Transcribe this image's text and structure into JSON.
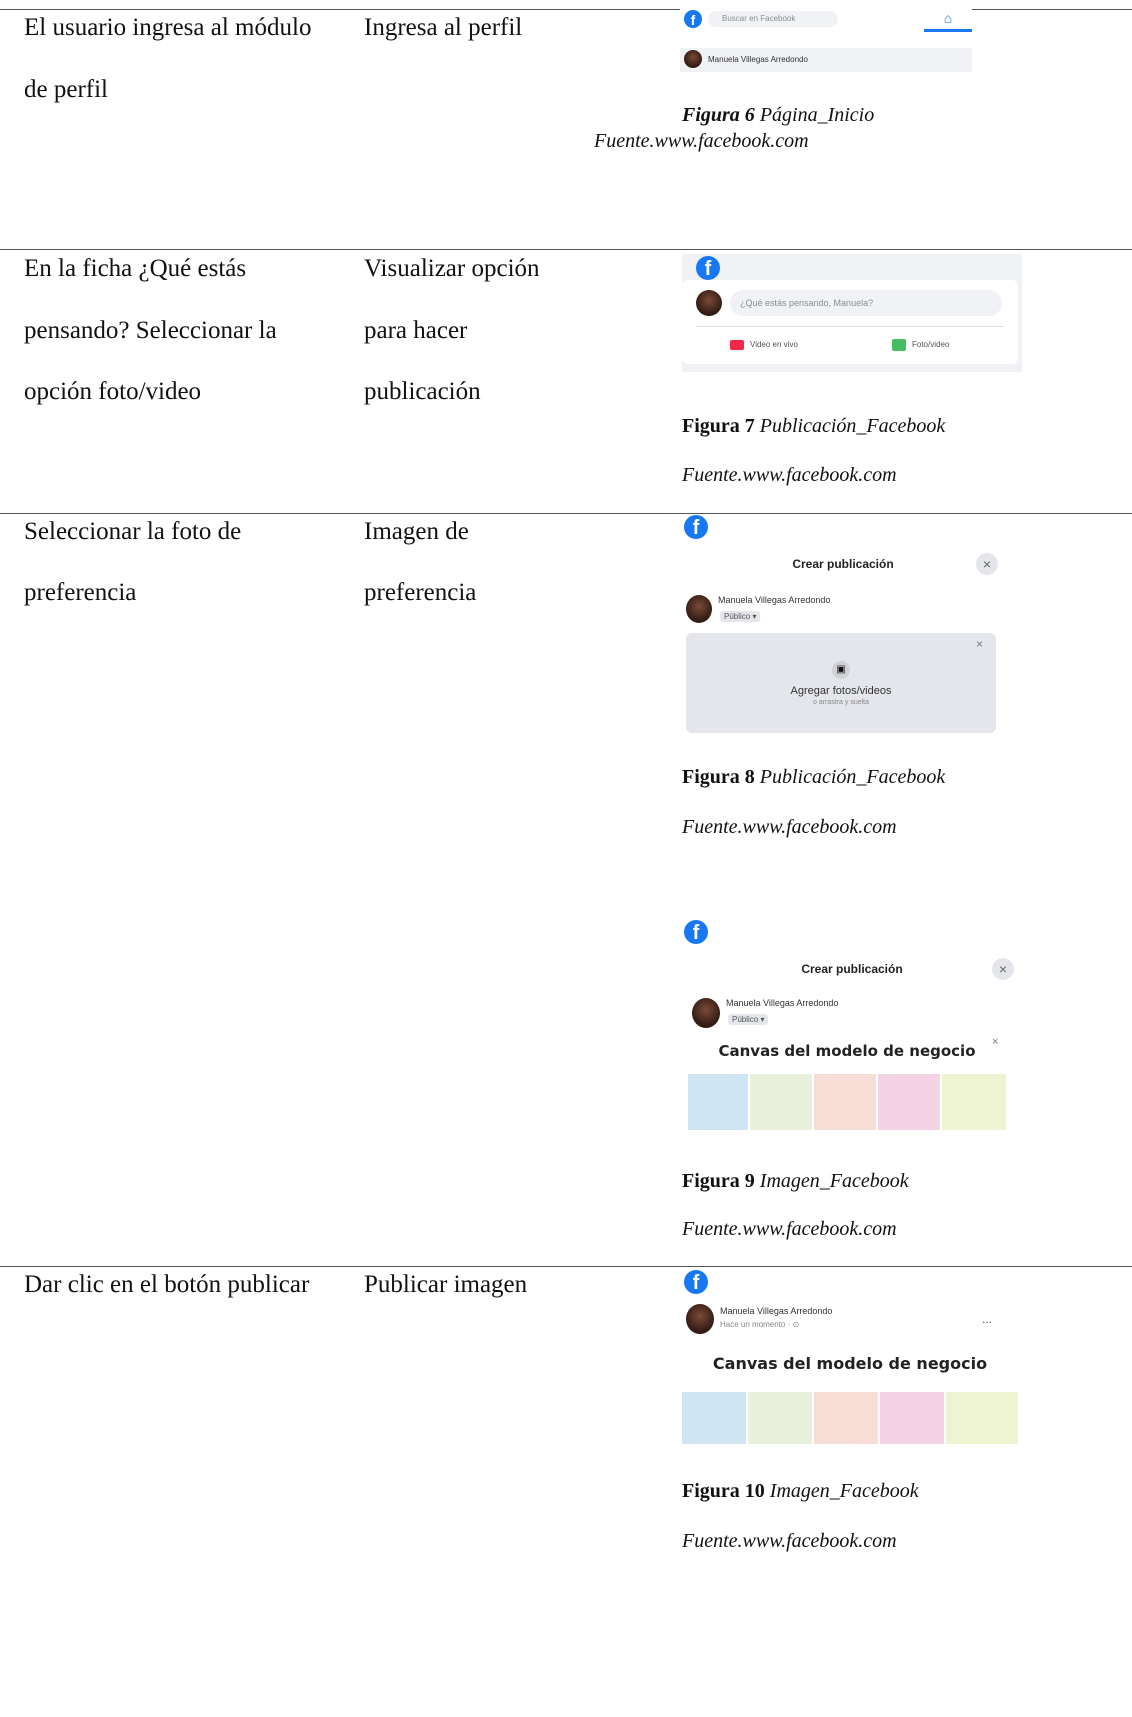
{
  "rows": [
    {
      "action": [
        "El usuario ingresa al módulo",
        "de perfil"
      ],
      "result": [
        "Ingresa al perfil"
      ]
    },
    {
      "action": [
        "En la ficha ¿Qué estás",
        "pensando? Seleccionar la",
        "opción foto/video"
      ],
      "result": [
        "Visualizar opción",
        "para hacer",
        "publicación"
      ]
    },
    {
      "action": [
        "Seleccionar la foto de",
        "preferencia"
      ],
      "result": [
        "Imagen de",
        "preferencia"
      ]
    },
    {
      "action": [
        "Dar clic en el botón publicar"
      ],
      "result": [
        "Publicar imagen"
      ]
    }
  ],
  "figures": {
    "f6": {
      "label": "Figura 6",
      "title": "Página_Inicio",
      "source": "Fuente.www.facebook.com"
    },
    "f7": {
      "label": "Figura 7",
      "title": "Publicación_Facebook",
      "source": "Fuente.www.facebook.com"
    },
    "f8": {
      "label": "Figura 8",
      "title": "Publicación_Facebook",
      "source": "Fuente.www.facebook.com"
    },
    "f9": {
      "label": "Figura 9",
      "title": "Imagen_Facebook",
      "source": "Fuente.www.facebook.com"
    },
    "f10": {
      "label": "Figura 10",
      "title": "Imagen_Facebook",
      "source": "Fuente.www.facebook.com"
    }
  },
  "screens": {
    "s1": {
      "search_placeholder": "Buscar en Facebook",
      "user": "Manuela Villegas Arredondo"
    },
    "s2": {
      "prompt": "¿Qué estás pensando, Manuela?",
      "live": "Video en vivo",
      "photo": "Foto/video"
    },
    "s3": {
      "header": "Crear publicación",
      "user": "Manuela Villegas Arredondo",
      "privacy": "Público ▾",
      "add": "Agregar fotos/videos",
      "drag": "o arrastra y suelta"
    },
    "s4": {
      "header": "Crear publicación",
      "user": "Manuela Villegas Arredondo",
      "privacy": "Público ▾",
      "canvas": "Canvas del modelo de negocio"
    },
    "s5": {
      "user": "Manuela Villegas Arredondo",
      "time": "Hace un momento · ⊙",
      "more": "...",
      "canvas": "Canvas del modelo de negocio"
    }
  },
  "colors": {
    "facebook_blue": "#1877f2",
    "canvas_tiles": [
      "#cfe6f2",
      "#e9f0dc",
      "#f7ddd5",
      "#f3d3e4",
      "#eef3d2"
    ]
  }
}
